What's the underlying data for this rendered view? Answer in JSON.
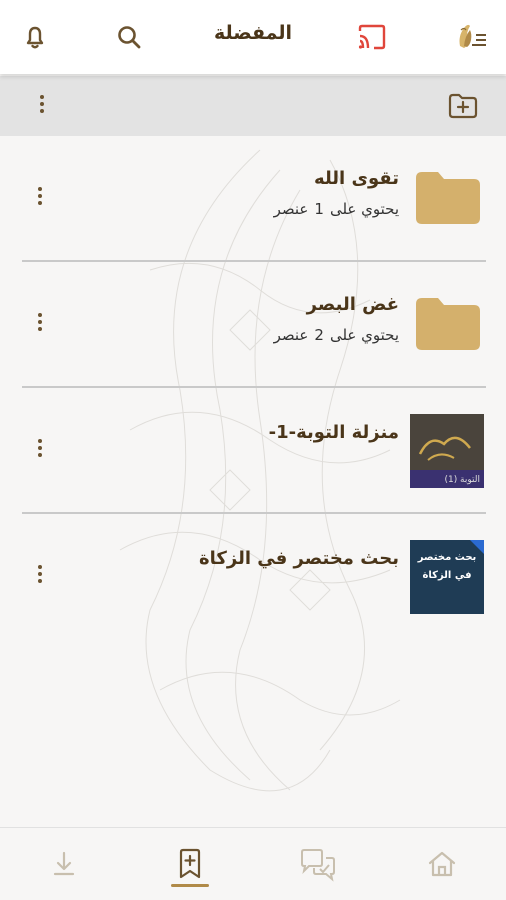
{
  "header": {
    "title": "المفضلة",
    "icons": [
      "menu-logo-icon",
      "cast-icon",
      "search-icon",
      "bell-icon"
    ],
    "accent_color": "#6b5330",
    "cast_color": "#e0463b"
  },
  "toolbar": {
    "icons": [
      "new-folder-icon",
      "more-options-icon"
    ]
  },
  "items": [
    {
      "type": "folder",
      "title": "تقوى الله",
      "sub_prefix": "يحتوي على",
      "count": "1",
      "sub_suffix": "عنصر"
    },
    {
      "type": "folder",
      "title": "غض البصر",
      "sub_prefix": "يحتوي على",
      "count": "2",
      "sub_suffix": "عنصر"
    },
    {
      "type": "media",
      "title": "منزلة التوبة-1-",
      "thumb_text": "التوبة (1)"
    },
    {
      "type": "media",
      "title": "بحث مختصر في الزكاة",
      "thumb_line1": "بحث مختصر",
      "thumb_line2": "في الزكاة"
    }
  ],
  "bottom_nav": {
    "items": [
      "download-icon",
      "favorites-icon",
      "questions-icon",
      "home-icon"
    ],
    "active": "favorites-icon"
  }
}
